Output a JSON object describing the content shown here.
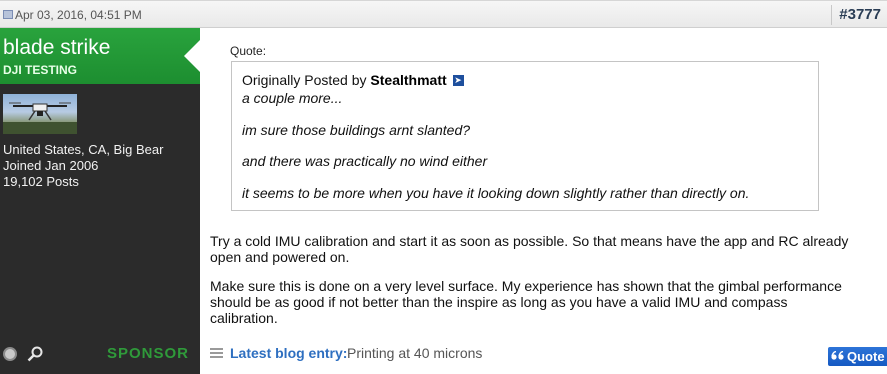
{
  "post": {
    "date": "Apr 03, 2016, 04:51 PM",
    "number": "#3777"
  },
  "user": {
    "name": "blade strike",
    "title": "DJI TESTING",
    "location": "United States, CA, Big Bear",
    "joined": "Joined Jan 2006",
    "posts": "19,102 Posts",
    "sponsor": "SPONSOR"
  },
  "quote": {
    "label": "Quote:",
    "posted_by_prefix": "Originally Posted by",
    "author": "Stealthmatt",
    "lines": [
      "a couple more...",
      "im sure those buildings arnt slanted?",
      "and there was practically no wind either",
      "it seems to be more when you have it looking down slightly rather than directly on."
    ]
  },
  "body": {
    "paragraphs": [
      "Try a cold IMU calibration and start it as soon as possible. So that means have the app and RC already open and powered on.",
      "Make sure this is done on a very level surface. My experience has shown that the gimbal performance should be as good if not better than the inspire as long as you have a valid IMU and compass calibration."
    ]
  },
  "blog": {
    "label": "Latest blog entry:",
    "title": "Printing at 40 microns"
  },
  "actions": {
    "quote_label": "Quote"
  },
  "colors": {
    "user_banner": "#29a33d",
    "user_panel": "#2b2b2b",
    "link_blue": "#2e6fc0",
    "quote_button": "#1f66cc"
  },
  "icons": {
    "post": "post-icon",
    "view_post": "view-post-icon",
    "online": "online-status-icon",
    "search": "search-icon",
    "blog": "list-icon",
    "quote": "quote-icon"
  }
}
